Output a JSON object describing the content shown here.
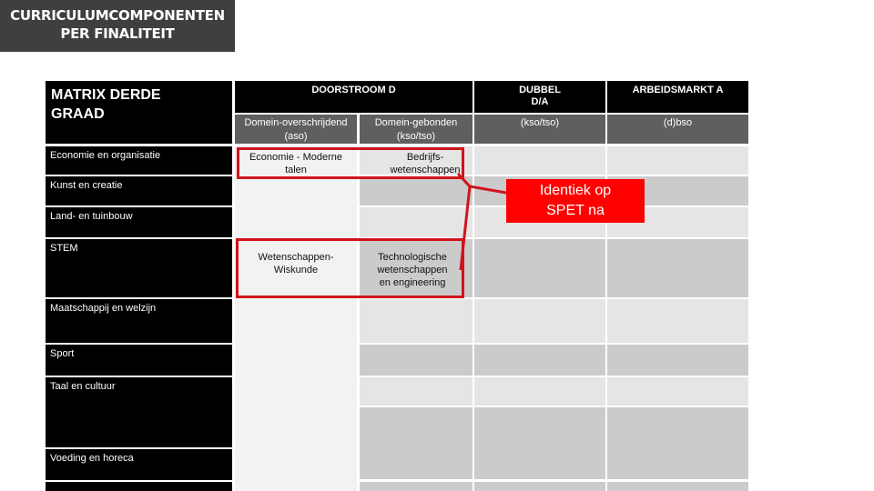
{
  "title": {
    "line1": "CURRICULUMCOMPONENTEN",
    "line2": "PER FINALITEIT"
  },
  "matrix": {
    "title_line1": "MATRIX DERDE",
    "title_line2": "GRAAD",
    "headers": {
      "doorstroom": "DOORSTROOM D",
      "dubbel_line1": "DUBBEL",
      "dubbel_line2": "D/A",
      "arbeidsmarkt": "ARBEIDSMARKT A"
    },
    "subheaders": {
      "domein_overschrijdend_line1": "Domein-overschrijdend",
      "domein_overschrijdend_line2": "(aso)",
      "domein_gebonden_line1": "Domein-gebonden",
      "domein_gebonden_line2": "(kso/tso)",
      "dubbel": "(kso/tso)",
      "arbeidsmarkt": "(d)bso"
    },
    "rows": [
      "Economie en organisatie",
      "Kunst en creatie",
      "Land- en tuinbouw",
      "STEM",
      "Maatschappij en welzijn",
      "Sport",
      "Taal en cultuur",
      "Voeding en horeca"
    ],
    "cells": {
      "economie_moderne_talen_line1": "Economie - Moderne",
      "economie_moderne_talen_line2": "talen",
      "bedrijfswetenschappen_line1": "Bedrijfs-",
      "bedrijfswetenschappen_line2": "wetenschappen",
      "wetenschappen_wiskunde_line1": "Wetenschappen-",
      "wetenschappen_wiskunde_line2": "Wiskunde",
      "technologische_line1": "Technologische",
      "technologische_line2": "wetenschappen",
      "technologische_line3": "en engineering"
    }
  },
  "callout": {
    "line1": "Identiek op",
    "line2": "SPET na",
    "color": "#ff0000"
  },
  "colors": {
    "highlight_border": "#d0141c",
    "header_black": "#000000",
    "subheader_gray": "#5f5f5f",
    "title_bg": "#3f3f3f"
  }
}
